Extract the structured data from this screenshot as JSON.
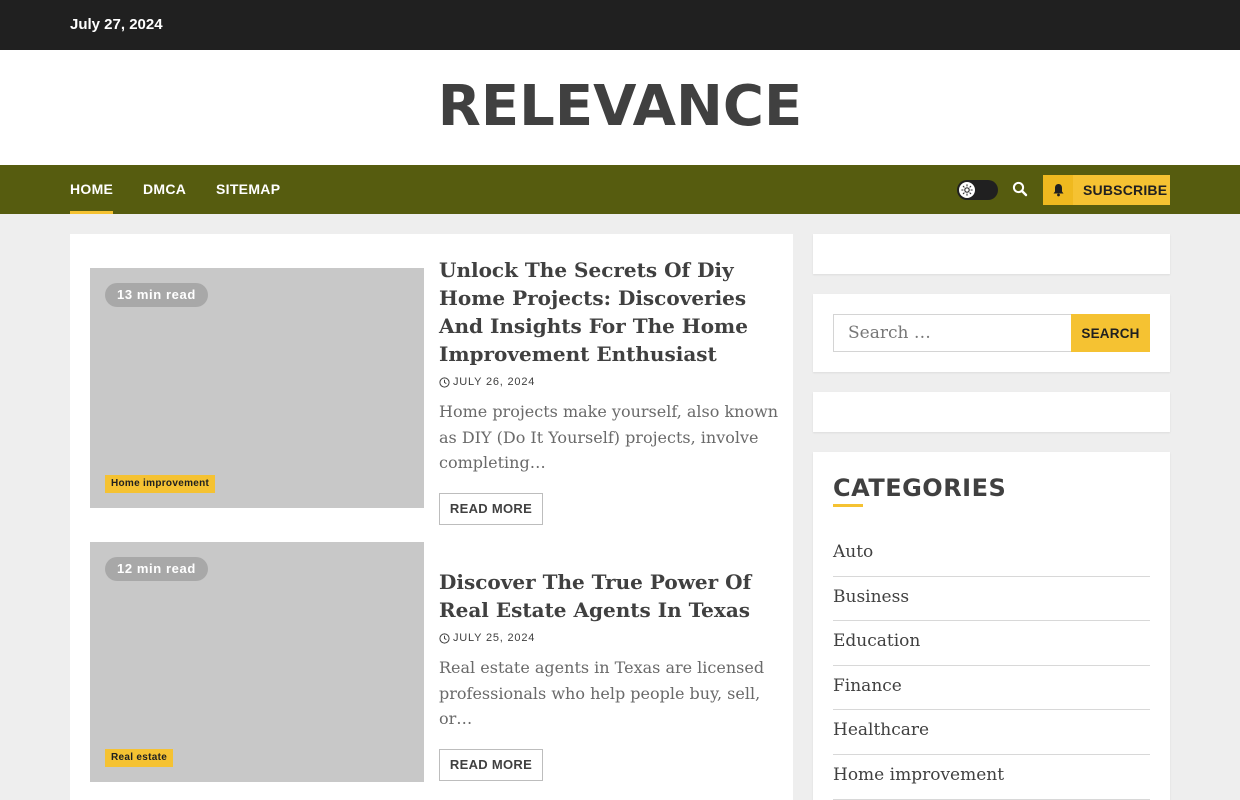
{
  "topbar": {
    "date": "July 27, 2024"
  },
  "site": {
    "title": "RELEVANCE"
  },
  "nav": {
    "items": [
      {
        "label": "HOME",
        "active": true
      },
      {
        "label": "DMCA",
        "active": false
      },
      {
        "label": "SITEMAP",
        "active": false
      }
    ],
    "subscribe_label": "SUBSCRIBE",
    "colors": {
      "nav_bg": "#565c0f",
      "accent": "#f5c232",
      "topbar_bg": "#202020"
    }
  },
  "posts": [
    {
      "read_time": "13 min read",
      "category": "Home improvement",
      "title": "Unlock The Secrets Of Diy Home Projects: Discoveries And Insights For The Home Improvement Enthusiast",
      "date": "JULY 26, 2024",
      "excerpt": "Home projects make yourself, also known as DIY (Do It Yourself) projects, involve completing…",
      "read_more": "READ MORE"
    },
    {
      "read_time": "12 min read",
      "category": "Real estate",
      "title": "Discover The True Power Of Real Estate Agents In Texas",
      "date": "JULY 25, 2024",
      "excerpt": "Real estate agents in Texas are licensed professionals who help people buy, sell, or…",
      "read_more": "READ MORE"
    }
  ],
  "sidebar": {
    "search": {
      "placeholder": "Search …",
      "button": "SEARCH"
    },
    "categories": {
      "title": "CATEGORIES",
      "items": [
        "Auto",
        "Business",
        "Education",
        "Finance",
        "Healthcare",
        "Home improvement"
      ]
    }
  },
  "icons": {
    "toggle": "sun-icon",
    "search": "search-icon",
    "bell": "bell-icon",
    "clock": "clock-icon"
  }
}
